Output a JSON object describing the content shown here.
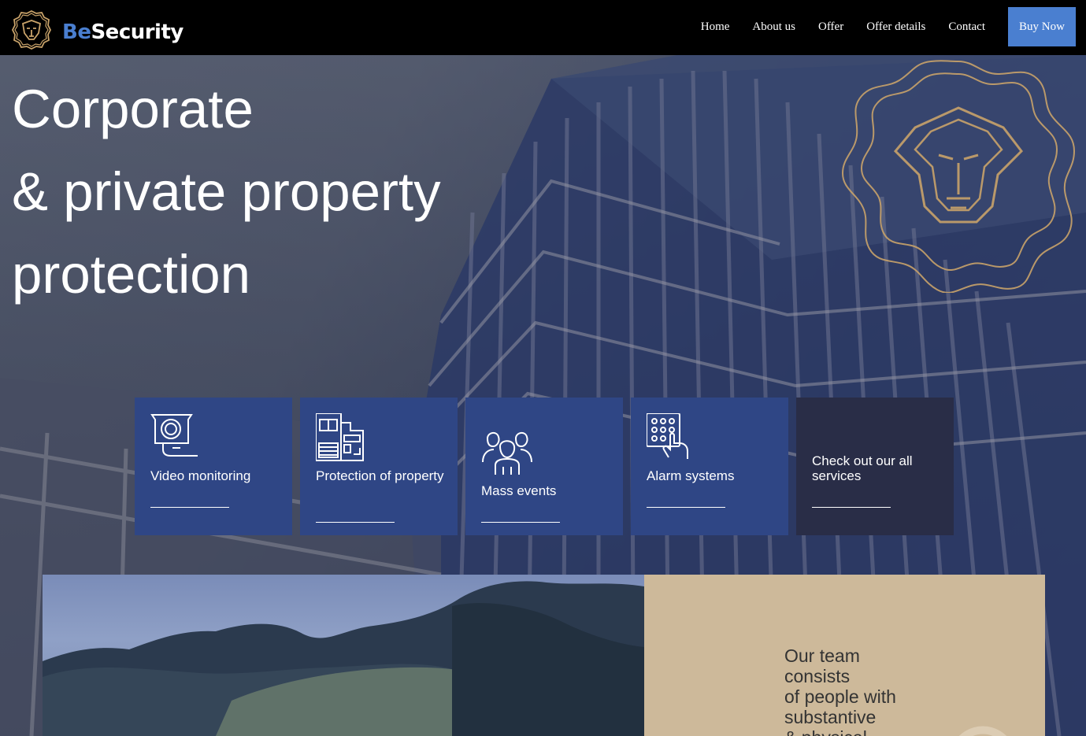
{
  "brand": {
    "name_part1": "Be",
    "name_part2": "Security",
    "logo_icon": "lion-shield-icon",
    "accent_color": "#4a7fd0",
    "gold_color": "#c9a36a"
  },
  "nav": {
    "items": [
      {
        "label": "Home"
      },
      {
        "label": "About us"
      },
      {
        "label": "Offer"
      },
      {
        "label": "Offer details"
      },
      {
        "label": "Contact"
      }
    ],
    "cta_label": "Buy Now"
  },
  "hero": {
    "title_lines": [
      "Corporate",
      "& private property",
      "protection"
    ]
  },
  "services": [
    {
      "label": "Video monitoring",
      "icon": "camera-icon"
    },
    {
      "label": "Protection of property",
      "icon": "building-icon"
    },
    {
      "label": "Mass events",
      "icon": "people-icon"
    },
    {
      "label": "Alarm systems",
      "icon": "keypad-icon"
    },
    {
      "label": "Check out our all services",
      "icon": ""
    }
  ],
  "team": {
    "text_lines": [
      "Our team",
      "consists",
      "of people with",
      "substantive",
      "& physical"
    ]
  },
  "colors": {
    "card_blue": "#2f4685",
    "card_dark": "#292d47",
    "team_bg": "#cdb99a"
  }
}
